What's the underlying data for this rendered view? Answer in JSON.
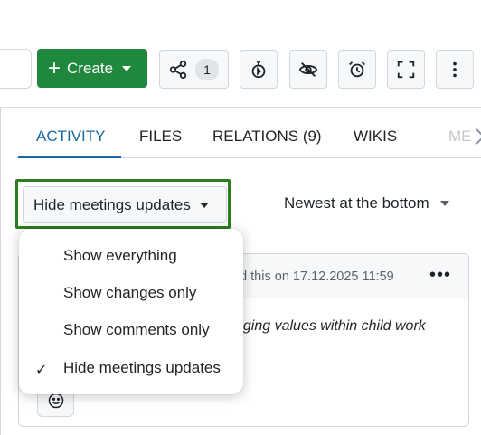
{
  "toolbar": {
    "create_label": "Create",
    "share_count": "1"
  },
  "tabs": [
    {
      "label": "ACTIVITY",
      "active": true
    },
    {
      "label": "FILES"
    },
    {
      "label": "RELATIONS (9)"
    },
    {
      "label": "WIKIS"
    },
    {
      "label": "ME"
    }
  ],
  "filter": {
    "selected": "Hide meetings updates",
    "options": [
      {
        "label": "Show everything",
        "checked": false
      },
      {
        "label": "Show changes only",
        "checked": false
      },
      {
        "label": "Show comments only",
        "checked": false
      },
      {
        "label": "Hide meetings updates",
        "checked": true
      }
    ]
  },
  "sort": {
    "label": "Newest at the bottom"
  },
  "activity": {
    "meta": "ed this on 17.12.2025 11:59",
    "body": "nging values within child work"
  },
  "colors": {
    "primary_green": "#1f883d",
    "accent_blue": "#1a67a3",
    "highlight_outline": "#2c7f1f"
  }
}
